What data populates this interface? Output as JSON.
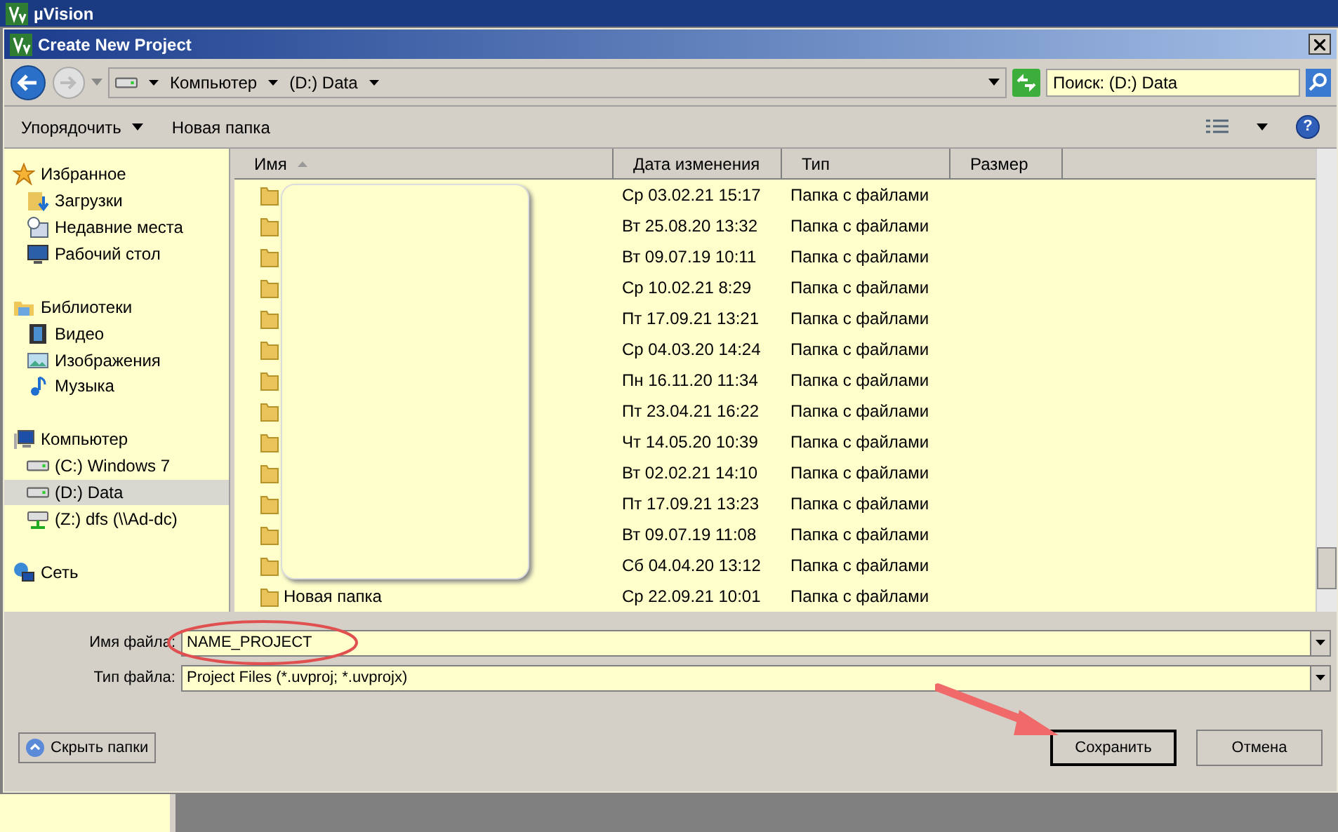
{
  "app_title": "µVision",
  "dialog": {
    "title": "Create New Project"
  },
  "address_bar": {
    "crumbs": [
      "Компьютер",
      "(D:) Data"
    ]
  },
  "search": {
    "placeholder": "Поиск: (D:) Data"
  },
  "toolbar": {
    "organize": "Упорядочить",
    "new_folder": "Новая папка"
  },
  "sidebar": {
    "groups": [
      {
        "label": "Избранное",
        "kind": "star",
        "selected": false,
        "children": [
          {
            "label": "Загрузки",
            "kind": "downloads",
            "selected": false
          },
          {
            "label": "Недавние места",
            "kind": "recent",
            "selected": false
          },
          {
            "label": "Рабочий стол",
            "kind": "desktop",
            "selected": false
          }
        ]
      },
      {
        "label": "Библиотеки",
        "kind": "library",
        "selected": false,
        "children": [
          {
            "label": "Видео",
            "kind": "video",
            "selected": false
          },
          {
            "label": "Изображения",
            "kind": "pictures",
            "selected": false
          },
          {
            "label": "Музыка",
            "kind": "music",
            "selected": false
          }
        ]
      },
      {
        "label": "Компьютер",
        "kind": "computer",
        "selected": false,
        "children": [
          {
            "label": "(C:) Windows 7",
            "kind": "drive",
            "selected": false
          },
          {
            "label": "(D:) Data",
            "kind": "drive",
            "selected": true
          },
          {
            "label": "(Z:) dfs (\\\\Ad-dc)",
            "kind": "netdrive",
            "selected": false
          }
        ]
      },
      {
        "label": "Сеть",
        "kind": "network",
        "selected": false
      }
    ]
  },
  "help": "?",
  "table": {
    "columns": [
      {
        "label": "Имя",
        "sorted": true
      },
      {
        "label": "Дата изменения",
        "sorted": false
      },
      {
        "label": "Тип",
        "sorted": false
      },
      {
        "label": "Размер",
        "sorted": false
      }
    ],
    "names_redacted": true,
    "rows": [
      {
        "date": "Ср 03.02.21 15:17",
        "type": "Папка с файлами"
      },
      {
        "date": "Вт 25.08.20 13:32",
        "type": "Папка с файлами"
      },
      {
        "date": "Вт 09.07.19 10:11",
        "type": "Папка с файлами"
      },
      {
        "date": "Ср 10.02.21 8:29",
        "type": "Папка с файлами"
      },
      {
        "date": "Пт 17.09.21 13:21",
        "type": "Папка с файлами"
      },
      {
        "date": "Ср 04.03.20 14:24",
        "type": "Папка с файлами"
      },
      {
        "date": "Пн 16.11.20 11:34",
        "type": "Папка с файлами"
      },
      {
        "date": "Пт 23.04.21 16:22",
        "type": "Папка с файлами"
      },
      {
        "date": "Чт 14.05.20 10:39",
        "type": "Папка с файлами"
      },
      {
        "date": "Вт 02.02.21 14:10",
        "type": "Папка с файлами"
      },
      {
        "date": "Пт 17.09.21 13:23",
        "type": "Папка с файлами"
      },
      {
        "date": "Вт 09.07.19 11:08",
        "type": "Папка с файлами"
      },
      {
        "date": "Сб 04.04.20 13:12",
        "type": "Папка с файлами"
      },
      {
        "name": "Новая папка",
        "date": "Ср 22.09.21 10:01",
        "type": "Папка с файлами"
      }
    ]
  },
  "file_name": {
    "label": "Имя файла:",
    "value": "NAME_PROJECT"
  },
  "file_type": {
    "label": "Тип файла:",
    "value": "Project Files (*.uvproj; *.uvprojx)"
  },
  "hide_folders": "Скрыть папки",
  "buttons": [
    {
      "label": "Сохранить",
      "default": true
    },
    {
      "label": "Отмена",
      "default": false
    }
  ]
}
